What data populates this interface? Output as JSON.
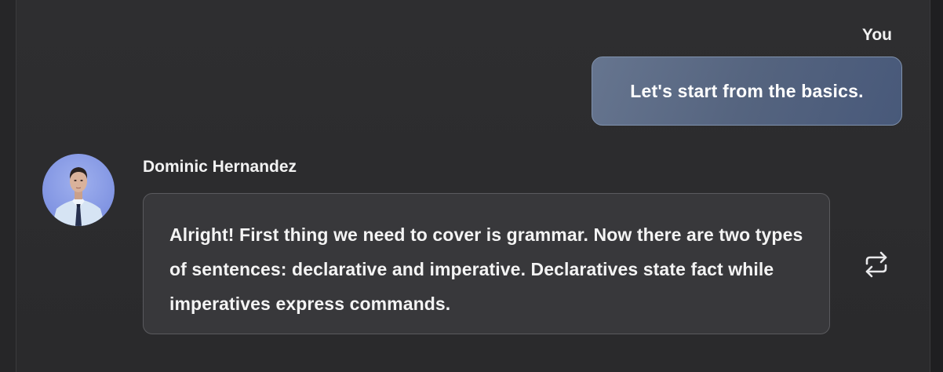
{
  "user_message": {
    "sender": "You",
    "text": "Let's start from the basics."
  },
  "bot_message": {
    "sender": "Dominic Hernandez",
    "text": "Alright! First thing we need to cover is grammar. Now there are two types of sentences: declarative and imperative. Declaratives state fact while imperatives express commands."
  },
  "icons": {
    "regenerate": "repeat-arrows-icon",
    "avatar": "avatar-photo"
  },
  "colors": {
    "background": "#2a2a2c",
    "user_bubble": "#5a6883",
    "bot_bubble": "#38383b",
    "text": "#f4f4f4"
  }
}
